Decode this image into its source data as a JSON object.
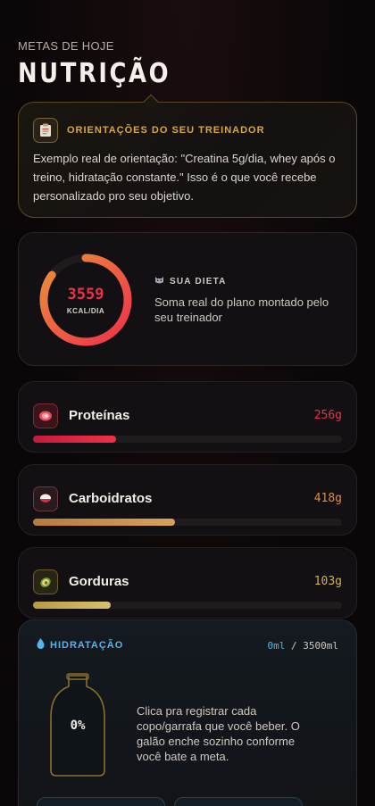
{
  "header": {
    "eyebrow": "METAS DE HOJE",
    "title": "NUTRIÇÃO"
  },
  "coach": {
    "icon": "clipboard-icon",
    "title": "ORIENTAÇÕES DO SEU TREINADOR",
    "body": "Exemplo real de orientação: \"Creatina 5g/dia, whey após o treino, hidratação constante.\" Isso é o que você recebe personalizado pro seu objetivo."
  },
  "diet": {
    "kcal_value": "3559",
    "kcal_unit": "KCAL/DIA",
    "progress": 0.85,
    "label": "SUA DIETA",
    "icon": "cat-icon",
    "description": "Soma real do plano montado pelo seu treinador"
  },
  "macros": [
    {
      "name": "Proteínas",
      "value": "256g",
      "progress": 0.27,
      "icon": "meat-icon",
      "color": "#f0304a"
    },
    {
      "name": "Carboidratos",
      "value": "418g",
      "progress": 0.46,
      "icon": "rice-bowl-icon",
      "color": "#e08a3a"
    },
    {
      "name": "Gorduras",
      "value": "103g",
      "progress": 0.25,
      "icon": "avocado-icon",
      "color": "#d8b04c"
    }
  ],
  "hydration": {
    "title": "HIDRATAÇÃO",
    "icon": "water-drop-icon",
    "current": "0ml",
    "separator": " / ",
    "goal": "3500ml",
    "percent_label": "0%",
    "progress": 0,
    "description": "Clica pra registrar cada copo/garrafa que você beber. O galão enche sozinho conforme você bate a meta."
  },
  "colors": {
    "accent_red": "#f0304a",
    "gold": "#d8a844",
    "water": "#56b4ec"
  }
}
